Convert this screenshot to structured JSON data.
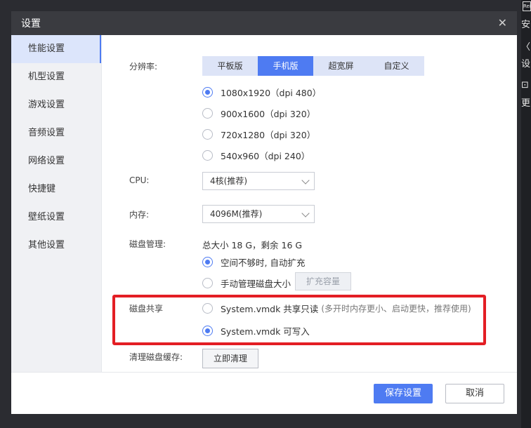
{
  "background_app": {
    "lines": [
      "Rei",
      "安",
      "〈",
      "设",
      "⊡",
      "更"
    ]
  },
  "dialog": {
    "title": "设置",
    "close_glyph": "✕"
  },
  "sidebar": {
    "items": [
      {
        "label": "性能设置",
        "active": true
      },
      {
        "label": "机型设置"
      },
      {
        "label": "游戏设置"
      },
      {
        "label": "音频设置"
      },
      {
        "label": "网络设置"
      },
      {
        "label": "快捷键"
      },
      {
        "label": "壁纸设置"
      },
      {
        "label": "其他设置"
      }
    ]
  },
  "resolution": {
    "label": "分辨率:",
    "tabs": [
      "平板版",
      "手机版",
      "超宽屏",
      "自定义"
    ],
    "active_tab": "手机版",
    "options": [
      "1080x1920（dpi 480）",
      "900x1600（dpi 320）",
      "720x1280（dpi 320）",
      "540x960（dpi 240）"
    ],
    "selected": "1080x1920（dpi 480）"
  },
  "cpu": {
    "label": "CPU:",
    "value": "4核(推荐)"
  },
  "memory": {
    "label": "内存:",
    "value": "4096M(推荐)"
  },
  "disk": {
    "label": "磁盘管理:",
    "summary": "总大小 18 G，剩余 16 G",
    "options": [
      "空间不够时, 自动扩充",
      "手动管理磁盘大小"
    ],
    "selected": "空间不够时, 自动扩充",
    "expand_button": "扩充容量"
  },
  "disk_share": {
    "label": "磁盘共享",
    "option_readonly": "System.vmdk 共享只读",
    "option_readonly_hint": "(多开时内存更小、启动更快，推荐使用)",
    "option_writable": "System.vmdk 可写入",
    "selected": "System.vmdk 可写入"
  },
  "cache": {
    "label": "清理磁盘缓存:",
    "button": "立即清理"
  },
  "footer": {
    "save": "保存设置",
    "cancel": "取消"
  },
  "colors": {
    "accent": "#4e7bf2",
    "highlight_border": "#e31e24",
    "titlebar": "#3a3b40"
  }
}
